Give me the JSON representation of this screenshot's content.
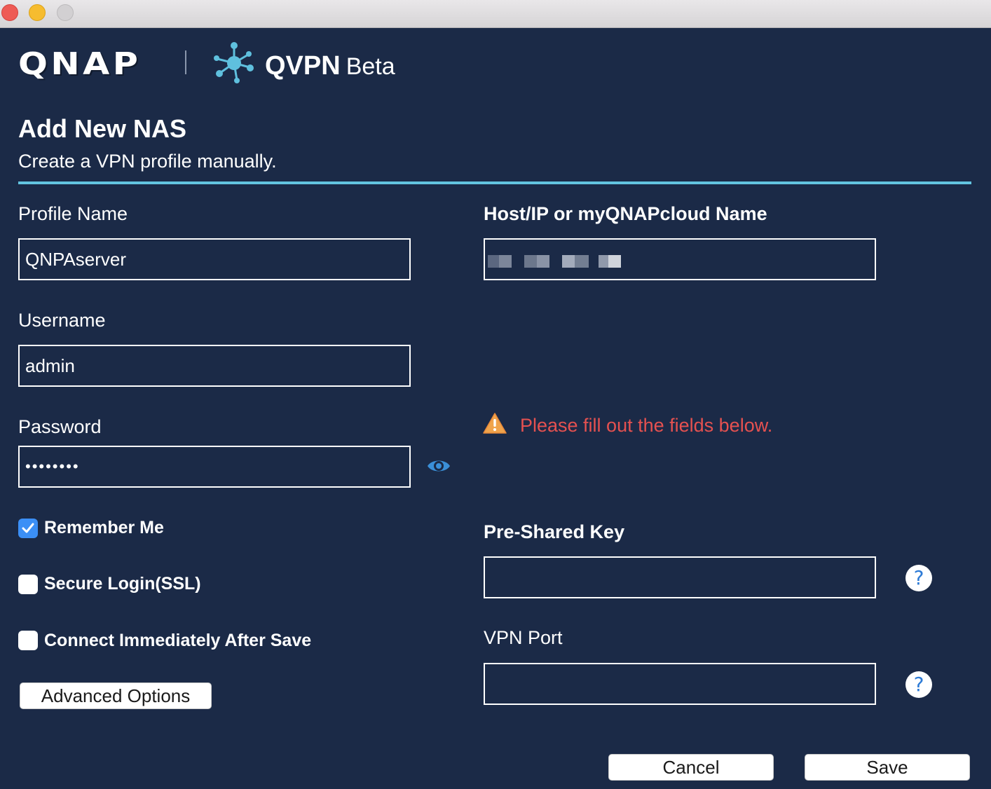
{
  "window": {
    "traffic_lights": [
      "close",
      "minimize",
      "zoom"
    ]
  },
  "brand": {
    "logo": "QNAP",
    "app_icon": "qvpn-network-icon",
    "app_name": "QVPN",
    "app_suffix": "Beta"
  },
  "header": {
    "title": "Add New NAS",
    "subtitle": "Create a VPN profile manually."
  },
  "form": {
    "profile_name": {
      "label": "Profile Name",
      "value": "QNPAserver"
    },
    "host": {
      "label": "Host/IP or myQNAPcloud Name",
      "value": ""
    },
    "username": {
      "label": "Username",
      "value": "admin"
    },
    "password": {
      "label": "Password",
      "masked_value": "••••••••"
    },
    "warning": {
      "icon": "warning-icon",
      "text": "Please fill out the fields below."
    },
    "pre_shared_key": {
      "label": "Pre-Shared Key",
      "value": ""
    },
    "vpn_port": {
      "label": "VPN Port",
      "value": ""
    },
    "help_glyph": "?"
  },
  "options": {
    "remember_me": {
      "label": "Remember Me",
      "checked": true
    },
    "secure_login": {
      "label": "Secure Login(SSL)",
      "checked": false
    },
    "connect_after_save": {
      "label": "Connect Immediately After Save",
      "checked": false
    }
  },
  "buttons": {
    "advanced": "Advanced Options",
    "cancel": "Cancel",
    "save": "Save"
  },
  "colors": {
    "background": "#1b2a47",
    "accent_line": "#63c4e0",
    "warning_text": "#e55150",
    "checkbox_checked": "#3b8ff6",
    "help_icon": "#2d7bd6"
  }
}
